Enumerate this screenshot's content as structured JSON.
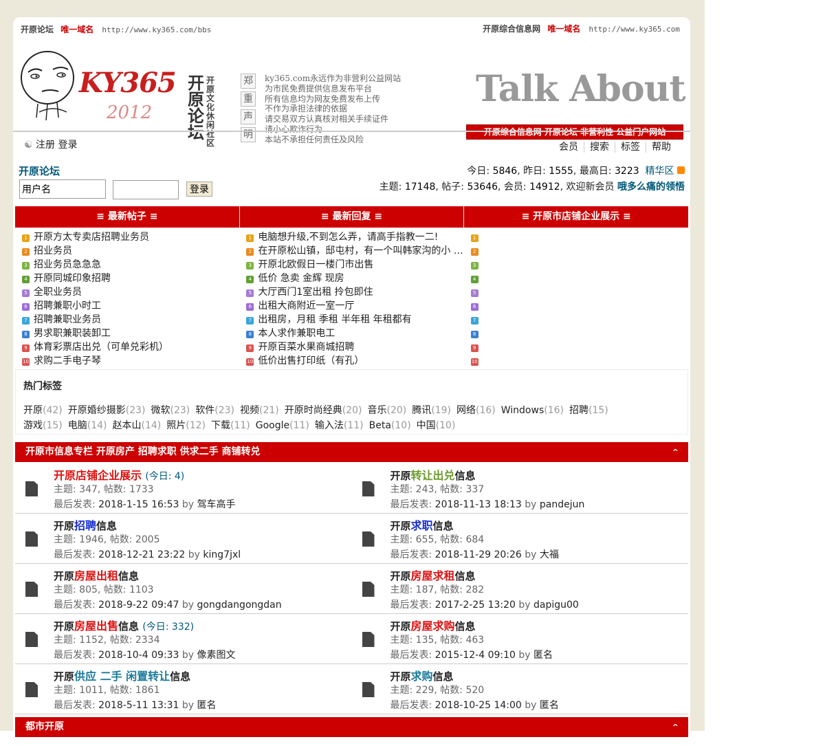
{
  "top": {
    "left_site": "开原论坛",
    "left_tag": "唯一域名",
    "left_url": "http://www.ky365.com/bbs",
    "right_site": "开原综合信息网",
    "right_tag": "唯一域名",
    "right_url": "http://www.ky365.com"
  },
  "header": {
    "logo_text": "KY365",
    "logo_sub": "2012",
    "vertical_title": "开原论坛",
    "vertical_sub": "开原文化休闲社区",
    "notice_chars": [
      "郑",
      "重",
      "声",
      "明"
    ],
    "notice_lines": [
      "ky365.com永远作为非营利公益网站",
      "为市民免费提供信息发布平台",
      "所有信息均为网友免费发布上传",
      "不作为承担法律的依据",
      "请交易双方认真核对相关手续证件",
      "请小心欺诈行为",
      "本站不承担任何责任及风险"
    ],
    "talk_about": "Talk About",
    "slogan": "开原综合信息网 开原论坛 非营利性 公益门户网站"
  },
  "userbar": {
    "register": "注册",
    "login": "登录",
    "menu": [
      "会员",
      "搜索",
      "标签",
      "帮助"
    ]
  },
  "forum": {
    "name": "开原论坛",
    "today_label": "今日:",
    "today": "5846",
    "yesterday_label": "昨日:",
    "yesterday": "1555",
    "max_label": "最高日:",
    "max": "3223",
    "digest": "精华区",
    "topics_label": "主题:",
    "topics": "17148",
    "posts_label": "帖子:",
    "posts": "53646",
    "members_label": "会员:",
    "members": "14912",
    "welcome": "欢迎新会员",
    "newest_member": "哦多么痛的领悟"
  },
  "login_form": {
    "username_value": "用户名",
    "password_value": "",
    "submit": "登录"
  },
  "columns": {
    "heads": [
      "≡ 最新帖子 ≡",
      "≡ 最新回复 ≡",
      "≡ 开原市店铺企业展示 ≡"
    ],
    "latest_posts": [
      "开原方太专卖店招聘业务员",
      "招业务员",
      "招业务员急急急",
      "开原同城印象招聘",
      "全职业务员",
      "招聘兼职小时工",
      "招聘兼职业务员",
      "男求职兼职装卸工",
      "体育彩票店出兑（可单兑彩机）",
      "求购二手电子琴"
    ],
    "latest_replies": [
      "电脑想升级,不到怎么弄，请高手指教一二!",
      "在开原松山镇，邸屯村，有一个叫韩家沟的小 …",
      "开原北欧假日一楼门市出售",
      "低价 急卖 金辉 现房",
      "大厅西门1室出租 拎包即住",
      "出租大商附近一室一厅",
      "出租房，月租 季租 半年租 年租都有",
      "本人求作兼职电工",
      "开原百菜水果商城招聘",
      "低价出售打印纸（有孔）"
    ],
    "shops": [
      "",
      "",
      "",
      "",
      "",
      "",
      "",
      "",
      "",
      ""
    ],
    "badge_colors": [
      "#e8a317",
      "#e98a1c",
      "#7cb542",
      "#5fa033",
      "#a57bd4",
      "#9d6dd6",
      "#3aa6d8",
      "#3c7fd0",
      "#d9534f",
      "#d9534f"
    ]
  },
  "tags": {
    "title": "热门标签",
    "row1": [
      [
        "开原",
        "(42)"
      ],
      [
        "开原婚纱摄影",
        "(23)"
      ],
      [
        "微软",
        "(23)"
      ],
      [
        "软件",
        "(23)"
      ],
      [
        "视频",
        "(21)"
      ],
      [
        "开原时尚经典",
        "(20)"
      ],
      [
        "音乐",
        "(20)"
      ],
      [
        "腾讯",
        "(19)"
      ],
      [
        "网络",
        "(16)"
      ],
      [
        "Windows",
        "(16)"
      ],
      [
        "招聘",
        "(15)"
      ]
    ],
    "row2": [
      [
        "游戏",
        "(15)"
      ],
      [
        "电脑",
        "(14)"
      ],
      [
        "赵本山",
        "(14)"
      ],
      [
        "照片",
        "(12)"
      ],
      [
        "下载",
        "(11)"
      ],
      [
        "Google",
        "(11)"
      ],
      [
        "输入法",
        "(11)"
      ],
      [
        "Beta",
        "(10)"
      ],
      [
        "中国",
        "(10)"
      ]
    ]
  },
  "section1": {
    "title": "开原市信息专栏 开原房产 招聘求职 供求二手 商铺转兑",
    "toggle": "^"
  },
  "section2": {
    "title": "都市开原",
    "toggle": "^"
  },
  "forums": [
    {
      "prefix": "",
      "hl": "开原店铺企业展示",
      "suffix": "",
      "hl_color": "#d11",
      "today": "(今日: 4)",
      "stat": "主题: 347, 帖数: 1733",
      "last": "2018-1-15 16:53",
      "by": "驾车高手"
    },
    {
      "prefix": "开原",
      "hl": "转让出兑",
      "suffix": "信息",
      "hl_color": "#6a9a2a",
      "today": "",
      "stat": "主题: 243, 帖数: 337",
      "last": "2018-11-13 18:13",
      "by": "pandejun"
    },
    {
      "prefix": "开原",
      "hl": "招聘",
      "suffix": "信息",
      "hl_color": "#1a2fd0",
      "today": "",
      "stat": "主题: 1946, 帖数: 2005",
      "last": "2018-12-21 23:22",
      "by": "king7jxl"
    },
    {
      "prefix": "开原",
      "hl": "求职",
      "suffix": "信息",
      "hl_color": "#1a2fd0",
      "today": "",
      "stat": "主题: 655, 帖数: 684",
      "last": "2018-11-29 20:26",
      "by": "大福"
    },
    {
      "prefix": "开原",
      "hl": "房屋出租",
      "suffix": "信息",
      "hl_color": "#d11",
      "today": "",
      "stat": "主题: 805, 帖数: 1103",
      "last": "2018-9-22 09:47",
      "by": "gongdangongdan"
    },
    {
      "prefix": "开原",
      "hl": "房屋求租",
      "suffix": "信息",
      "hl_color": "#d11",
      "today": "",
      "stat": "主题: 187, 帖数: 282",
      "last": "2017-2-25 13:20",
      "by": "dapigu00"
    },
    {
      "prefix": "开原",
      "hl": "房屋出售",
      "suffix": "信息",
      "hl_color": "#d11",
      "today": "(今日: 332)",
      "stat": "主题: 1152, 帖数: 2334",
      "last": "2018-10-4 09:33",
      "by": "像素图文"
    },
    {
      "prefix": "开原",
      "hl": "房屋求购",
      "suffix": "信息",
      "hl_color": "#d11",
      "today": "",
      "stat": "主题: 135, 帖数: 463",
      "last": "2015-12-4 09:10",
      "by": "匿名"
    },
    {
      "prefix": "开原",
      "hl": "供应 二手 闲置转让",
      "suffix": "信息",
      "hl_color": "#1a7a9a",
      "today": "",
      "stat": "主题: 1011, 帖数: 1861",
      "last": "2018-5-11 13:31",
      "by": "匿名"
    },
    {
      "prefix": "开原",
      "hl": "求购",
      "suffix": "信息",
      "hl_color": "#1a7a9a",
      "today": "",
      "stat": "主题: 229, 帖数: 520",
      "last": "2018-10-25 14:00",
      "by": "匿名"
    }
  ],
  "labels": {
    "last_post": "最后发表:",
    "by": "by"
  }
}
